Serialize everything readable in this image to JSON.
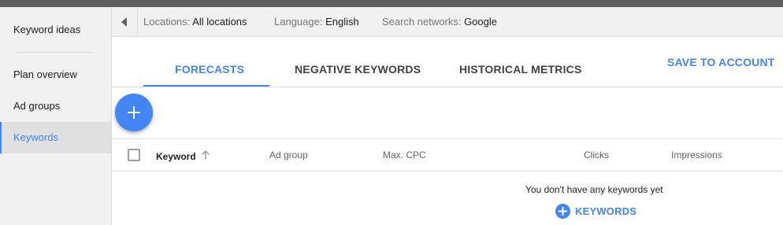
{
  "sidebar": {
    "items": [
      {
        "label": "Keyword ideas"
      },
      {
        "label": "Plan overview"
      },
      {
        "label": "Ad groups"
      },
      {
        "label": "Keywords"
      }
    ]
  },
  "filters": {
    "locations_label": "Locations:",
    "locations_value": "All locations",
    "language_label": "Language:",
    "language_value": "English",
    "networks_label": "Search networks:",
    "networks_value": "Google"
  },
  "tabs": [
    {
      "label": "FORECASTS"
    },
    {
      "label": "NEGATIVE KEYWORDS"
    },
    {
      "label": "HISTORICAL METRICS"
    }
  ],
  "toolbar": {
    "save_label": "SAVE TO ACCOUNT"
  },
  "table": {
    "columns": [
      "Keyword",
      "Ad group",
      "Max. CPC",
      "Clicks",
      "Impressions"
    ],
    "empty_message": "You don't have any keywords yet",
    "add_label": "KEYWORDS"
  },
  "colors": {
    "accent": "#4285f4",
    "sidebar_bg": "#f1f1f1",
    "active_bg": "#e0e0e0",
    "topbar": "#5f5f5f"
  },
  "icons": {
    "collapse": "triangle-left-icon",
    "fab": "plus-icon",
    "sort": "arrow-up-icon",
    "add": "plus-circle-icon"
  }
}
